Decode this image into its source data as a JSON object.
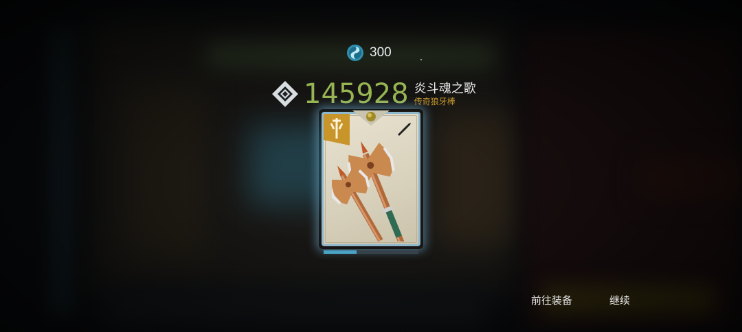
{
  "currency": {
    "icon": "spirit-orb-icon",
    "amount": "300"
  },
  "item": {
    "power_icon": "power-gem-icon",
    "power": "145928",
    "name": "炎斗魂之歌",
    "rarity": "传奇狼牙棒",
    "class_icon": "warrior-class-icon",
    "type_icon": "weapon-type-icon",
    "art": "twin-war-axes",
    "progress": 0.35
  },
  "buttons": {
    "equip": "前往装备",
    "continue": "继续"
  },
  "colors": {
    "power": "#97b553",
    "rarity": "#c89a2d",
    "card_border": "#8fb8cc",
    "progress": "#4aa3c4"
  }
}
